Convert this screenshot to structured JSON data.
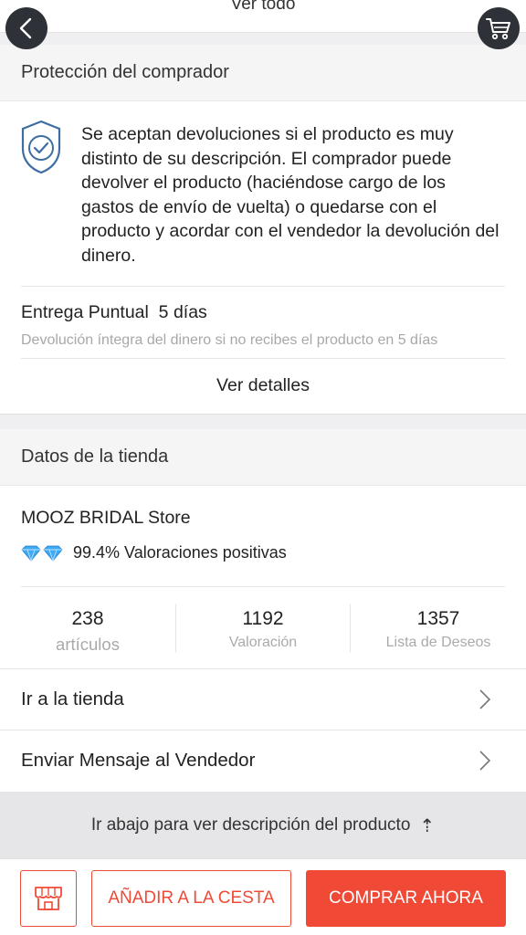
{
  "top": {
    "ver_todo": "Ver todo"
  },
  "protection": {
    "header": "Protección del comprador",
    "text": "Se aceptan devoluciones si el producto es muy distinto de su descripción. El comprador puede devolver el producto (haciéndose cargo de los gastos de envío de vuelta) o quedarse con el producto y acordar con el vendedor la devolución del dinero.",
    "delivery_title": "Entrega Puntual  5 días",
    "delivery_sub": "Devolución íntegra del dinero si no recibes el producto en 5 días",
    "details_link": "Ver detalles"
  },
  "store": {
    "header": "Datos de la tienda",
    "name": "MOOZ BRIDAL Store",
    "rating": "99.4% Valoraciones positivas",
    "stats": [
      {
        "value": "238",
        "label": "artículos"
      },
      {
        "value": "1192",
        "label": "Valoración"
      },
      {
        "value": "1357",
        "label": "Lista de Deseos"
      }
    ],
    "goto_store": "Ir a la tienda",
    "message_seller": "Enviar Mensaje al Vendedor"
  },
  "scroll_hint": "Ir abajo para ver descripción del producto",
  "scroll_arrow": "⇡",
  "actions": {
    "add_to_cart": "AÑADIR A LA CESTA",
    "buy_now": "COMPRAR AHORA"
  },
  "colors": {
    "accent": "#f04a36",
    "icon_blue": "#3d6da3",
    "diamond": "#3fa9f5",
    "dark_button": "#2e3138"
  }
}
